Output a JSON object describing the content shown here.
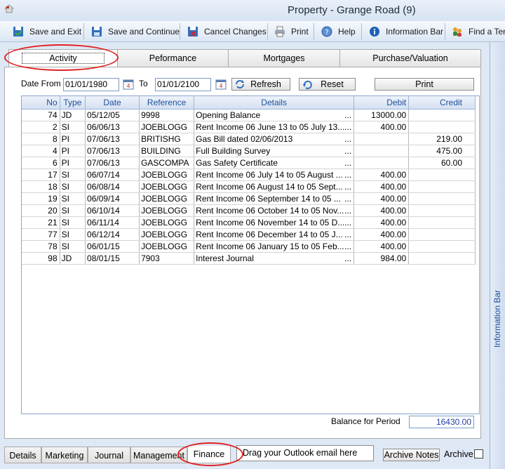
{
  "window": {
    "title": "Property  - Grange Road (9)"
  },
  "toolbar": {
    "save_exit": "Save and Exit",
    "save_continue": "Save and Continue",
    "cancel_changes": "Cancel Changes",
    "print": "Print",
    "help": "Help",
    "information_bar": "Information Bar",
    "find_tenant": "Find a Ten"
  },
  "top_tabs": [
    "Activity",
    "Peformance",
    "Mortgages",
    "Purchase/Valuation"
  ],
  "filter": {
    "date_from_label": "Date From",
    "date_from_value": "01/01/1980",
    "to_label": "To",
    "to_value": "01/01/2100",
    "refresh_label": "Refresh",
    "reset_label": "Reset",
    "print_label": "Print"
  },
  "columns": [
    "No",
    "Type",
    "Date",
    "Reference",
    "Details",
    "Debit",
    "Credit"
  ],
  "rows": [
    {
      "no": "74",
      "type": "JD",
      "date": "05/12/05",
      "ref": "9998",
      "details": "Opening Balance",
      "debit": "13000.00",
      "credit": ""
    },
    {
      "no": "2",
      "type": "SI",
      "date": "06/06/13",
      "ref": "JOEBLOGG",
      "details": "Rent Income 06 June 13 to 05 July 13...",
      "debit": "400.00",
      "credit": ""
    },
    {
      "no": "8",
      "type": "PI",
      "date": "07/06/13",
      "ref": "BRITISHG",
      "details": "Gas Bill dated 02/06/2013",
      "debit": "",
      "credit": "219.00"
    },
    {
      "no": "4",
      "type": "PI",
      "date": "07/06/13",
      "ref": "BUILDING",
      "details": "Full Building Survey",
      "debit": "",
      "credit": "475.00"
    },
    {
      "no": "6",
      "type": "PI",
      "date": "07/06/13",
      "ref": "GASCOMPA",
      "details": "Gas Safety Certificate",
      "debit": "",
      "credit": "60.00"
    },
    {
      "no": "17",
      "type": "SI",
      "date": "06/07/14",
      "ref": "JOEBLOGG",
      "details": "Rent Income 06 July 14 to 05 August ...",
      "debit": "400.00",
      "credit": ""
    },
    {
      "no": "18",
      "type": "SI",
      "date": "06/08/14",
      "ref": "JOEBLOGG",
      "details": "Rent Income 06 August 14 to 05 Sept...",
      "debit": "400.00",
      "credit": ""
    },
    {
      "no": "19",
      "type": "SI",
      "date": "06/09/14",
      "ref": "JOEBLOGG",
      "details": "Rent Income 06 September 14 to 05 ...",
      "debit": "400.00",
      "credit": ""
    },
    {
      "no": "20",
      "type": "SI",
      "date": "06/10/14",
      "ref": "JOEBLOGG",
      "details": "Rent Income 06 October 14 to 05 Nov...",
      "debit": "400.00",
      "credit": ""
    },
    {
      "no": "21",
      "type": "SI",
      "date": "06/11/14",
      "ref": "JOEBLOGG",
      "details": "Rent Income 06 November 14 to 05 D...",
      "debit": "400.00",
      "credit": ""
    },
    {
      "no": "77",
      "type": "SI",
      "date": "06/12/14",
      "ref": "JOEBLOGG",
      "details": "Rent Income 06 December 14 to 05 J...",
      "debit": "400.00",
      "credit": ""
    },
    {
      "no": "78",
      "type": "SI",
      "date": "06/01/15",
      "ref": "JOEBLOGG",
      "details": "Rent Income 06 January 15 to 05 Feb...",
      "debit": "400.00",
      "credit": ""
    },
    {
      "no": "98",
      "type": "JD",
      "date": "08/01/15",
      "ref": "7903",
      "details": "Interest Journal",
      "debit": "984.00",
      "credit": ""
    }
  ],
  "balance": {
    "label": "Balance for Period",
    "value": "16430.00"
  },
  "bottom_tabs": [
    "Details",
    "Marketing",
    "Journal",
    "Management",
    "Finance"
  ],
  "drag_text": "Drag your Outlook email here",
  "archive_notes_label": "Archive Notes",
  "archive_label": "Archive",
  "info_bar_label": "Information Bar",
  "colors": {
    "accent": "#1f4f9b",
    "annotation": "#e02020"
  }
}
